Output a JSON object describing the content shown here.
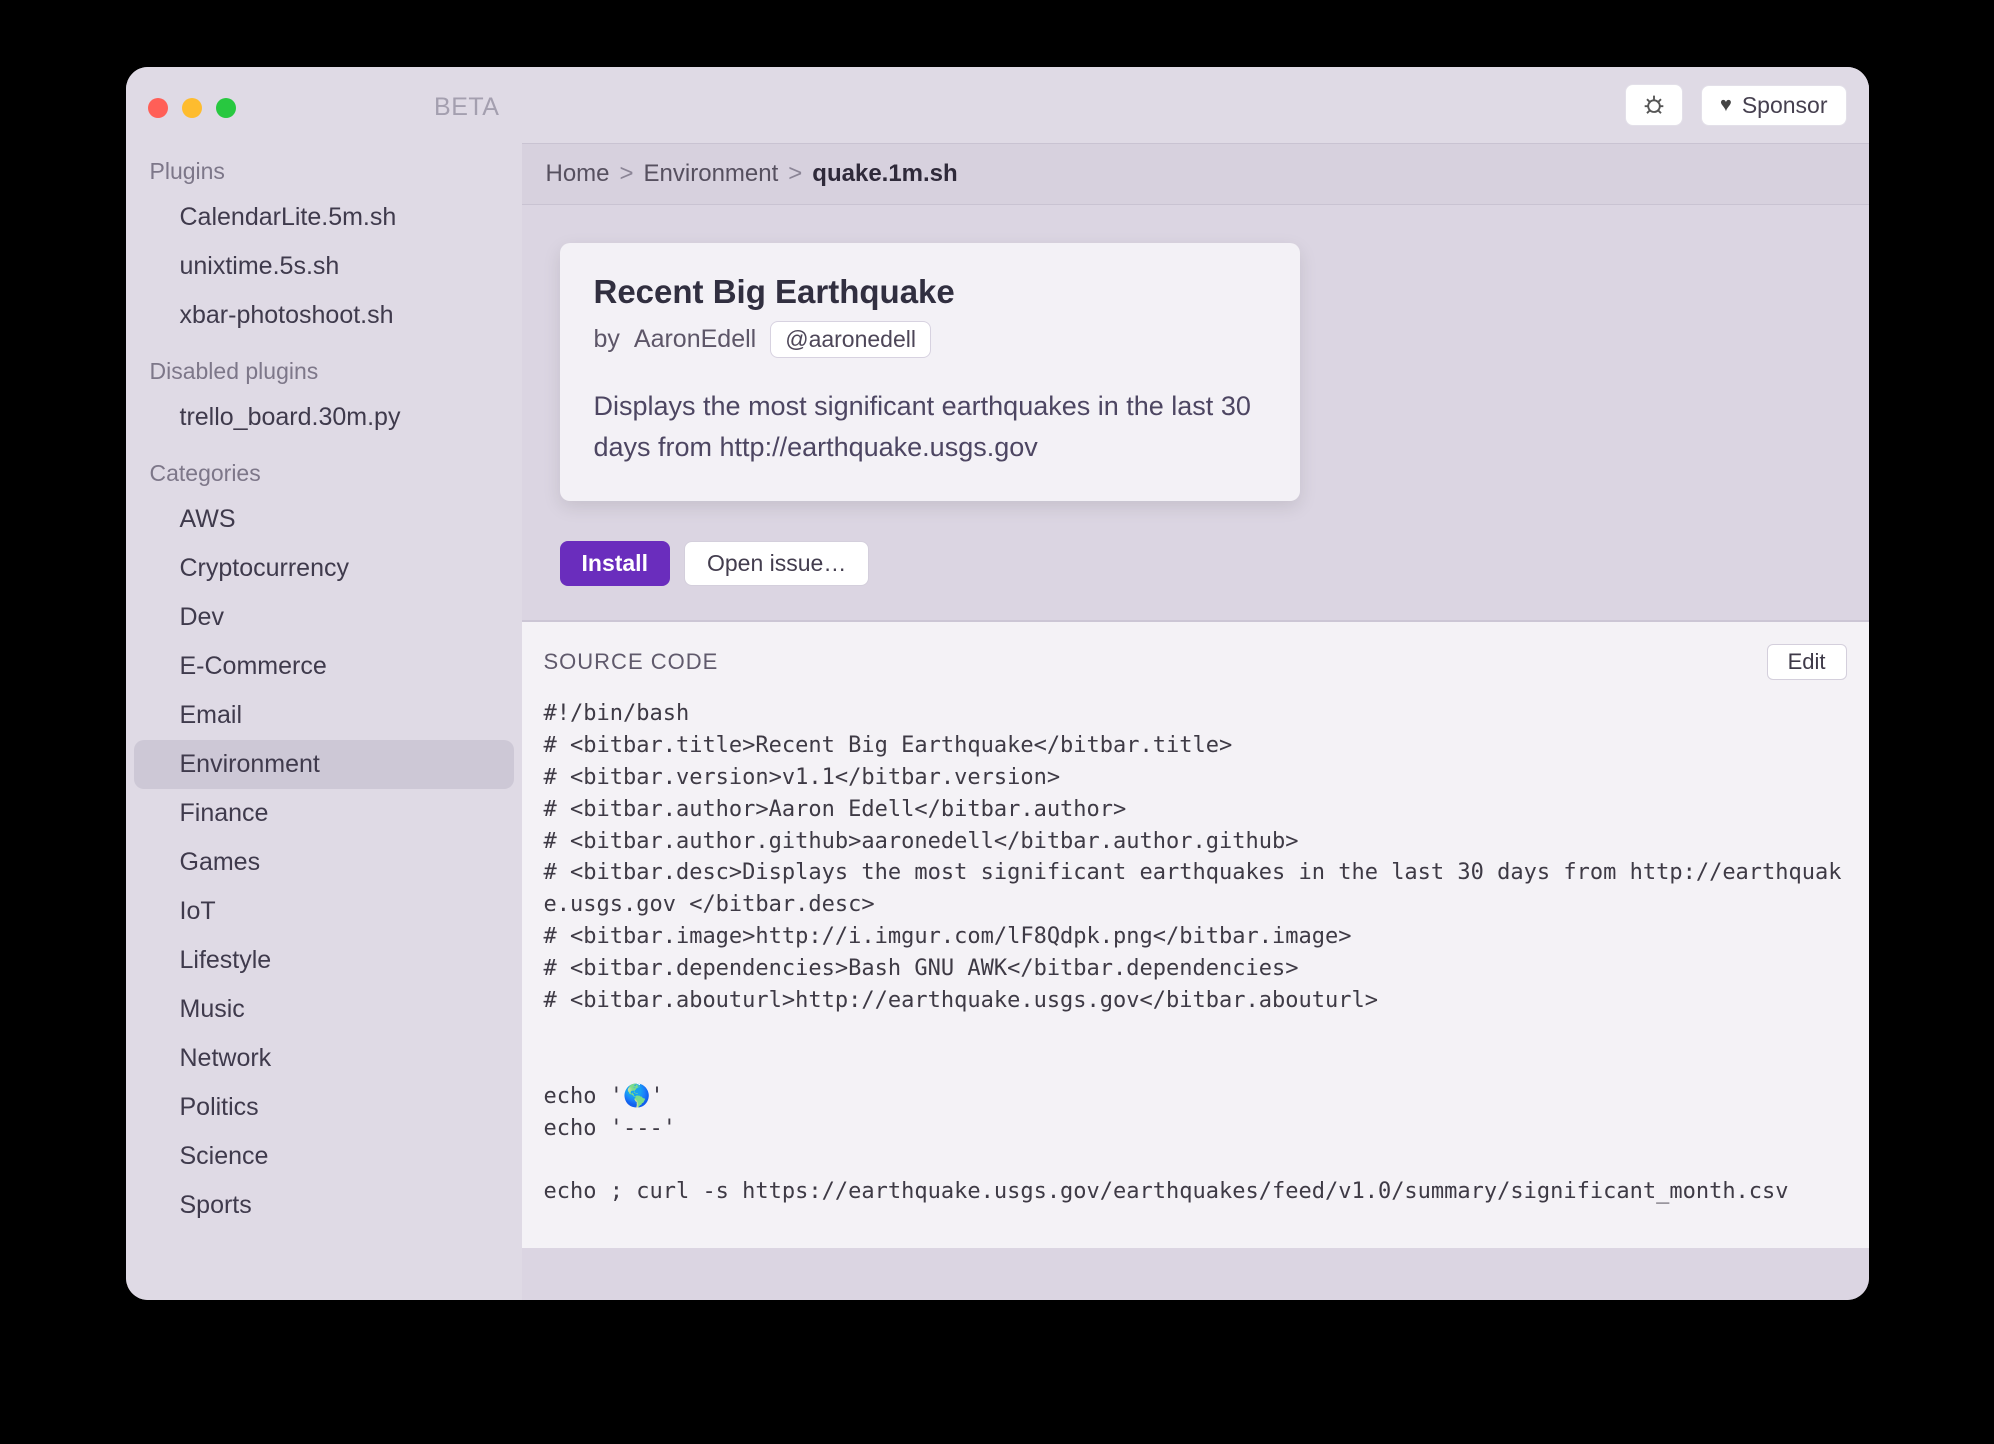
{
  "window": {
    "badge": "BETA"
  },
  "sidebar": {
    "plugins_header": "Plugins",
    "plugins": [
      "CalendarLite.5m.sh",
      "unixtime.5s.sh",
      "xbar-photoshoot.sh"
    ],
    "disabled_header": "Disabled plugins",
    "disabled": [
      "trello_board.30m.py"
    ],
    "categories_header": "Categories",
    "categories": [
      "AWS",
      "Cryptocurrency",
      "Dev",
      "E-Commerce",
      "Email",
      "Environment",
      "Finance",
      "Games",
      "IoT",
      "Lifestyle",
      "Music",
      "Network",
      "Politics",
      "Science",
      "Sports"
    ],
    "selected_category": "Environment"
  },
  "topbar": {
    "sponsor_label": "Sponsor"
  },
  "breadcrumb": {
    "items": [
      "Home",
      "Environment"
    ],
    "current": "quake.1m.sh",
    "sep": ">"
  },
  "plugin": {
    "title": "Recent Big Earthquake",
    "by_prefix": "by",
    "author": "AaronEdell",
    "handle": "@aaronedell",
    "description": "Displays the most significant earthquakes in the last 30 days from http://earthquake.usgs.gov"
  },
  "actions": {
    "install": "Install",
    "open_issue": "Open issue…"
  },
  "source": {
    "header": "SOURCE CODE",
    "edit": "Edit",
    "code": "#!/bin/bash\n# <bitbar.title>Recent Big Earthquake</bitbar.title>\n# <bitbar.version>v1.1</bitbar.version>\n# <bitbar.author>Aaron Edell</bitbar.author>\n# <bitbar.author.github>aaronedell</bitbar.author.github>\n# <bitbar.desc>Displays the most significant earthquakes in the last 30 days from http://earthquake.usgs.gov </bitbar.desc>\n# <bitbar.image>http://i.imgur.com/lF8Qdpk.png</bitbar.image>\n# <bitbar.dependencies>Bash GNU AWK</bitbar.dependencies>\n# <bitbar.abouturl>http://earthquake.usgs.gov</bitbar.abouturl>\n\n\necho '🌎'\necho '---'\n\necho ; curl -s https://earthquake.usgs.gov/earthquakes/feed/v1.0/summary/significant_month.csv"
  }
}
